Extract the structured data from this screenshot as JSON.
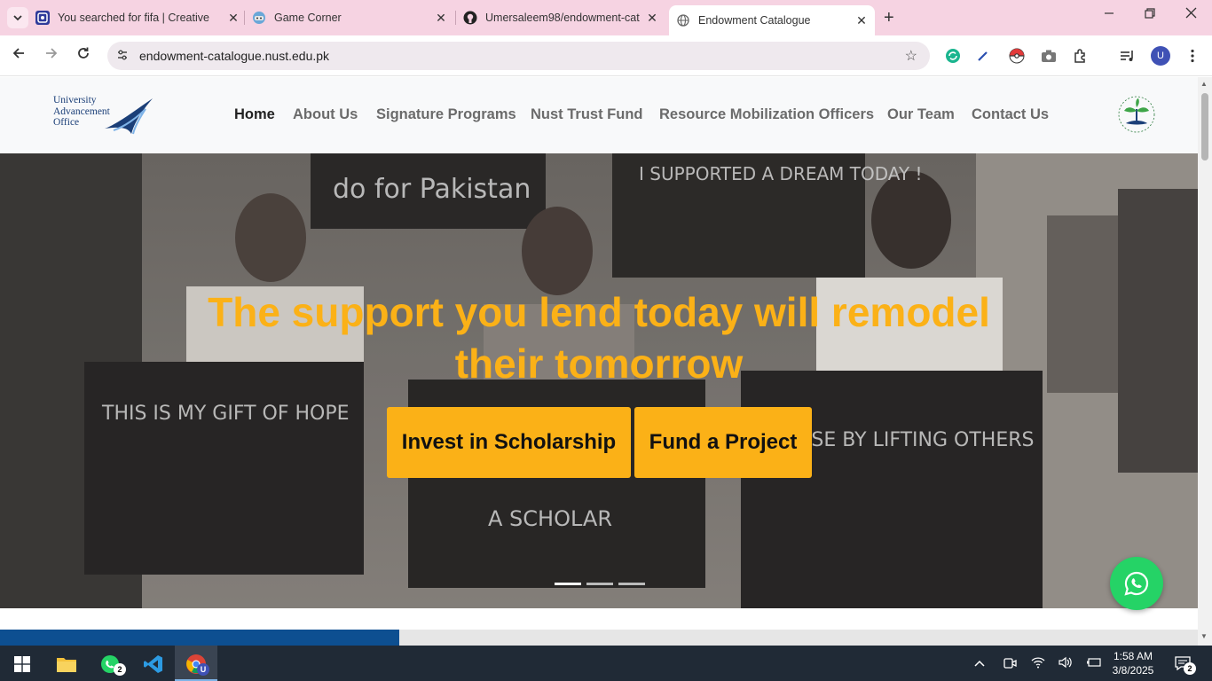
{
  "browser": {
    "tabs": [
      {
        "title": "You searched for fifa | Creative",
        "icon": "creative-logo-icon"
      },
      {
        "title": "Game Corner",
        "icon": "game-corner-icon"
      },
      {
        "title": "Umersaleem98/endowment-cat",
        "icon": "github-icon"
      },
      {
        "title": "Endowment Catalogue",
        "icon": "globe-icon",
        "active": true
      }
    ],
    "url": "endowment-catalogue.nust.edu.pk",
    "profile_initial": "U"
  },
  "site": {
    "logo_lines": [
      "University",
      "Advancement",
      "Office"
    ],
    "nav": [
      "Home",
      "About Us",
      "Signature Programs",
      "Nust Trust Fund",
      "Resource Mobilization Officers",
      "Our Team",
      "Contact Us"
    ],
    "active_nav": "Home",
    "hero": {
      "title_line1": "The support you lend today will remodel",
      "title_line2": "their tomorrow",
      "cta_primary": "Invest in Scholarship",
      "cta_secondary": "Fund a Project",
      "slides": 3,
      "active_slide": 1,
      "photo_signs": [
        "do for Pakistan",
        "I SUPPORTED A DREAM TODAY !",
        "THIS IS MY GIFT OF HOPE",
        "A SCHOLAR",
        "WE RISE BY LIFTING OTHERS"
      ]
    },
    "colors": {
      "accent": "#fbb117",
      "brand_blue": "#0d4f91",
      "whatsapp": "#25d366"
    }
  },
  "taskbar": {
    "time": "1:58 AM",
    "date": "3/8/2025",
    "whatsapp_badge": "2",
    "notification_badge": "2"
  }
}
